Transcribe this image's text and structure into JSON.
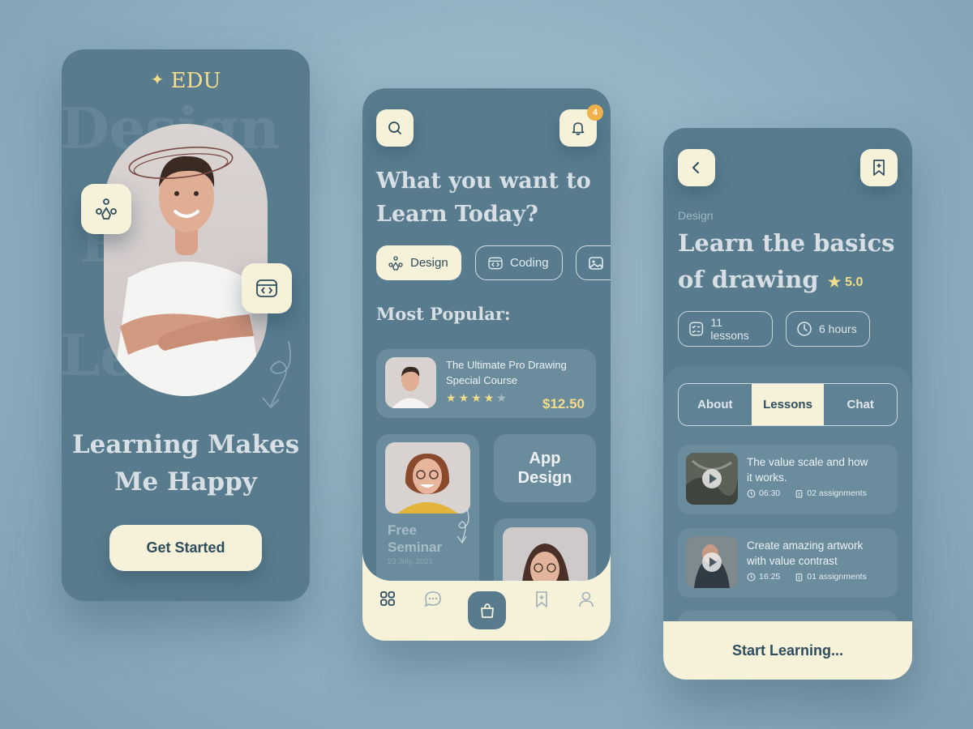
{
  "screen1": {
    "logo_text": "EDU",
    "bg_words": [
      "Design",
      "Pli",
      "Le"
    ],
    "headline_line1": "Learning Makes",
    "headline_line2": "Me Happy",
    "cta_label": "Get Started",
    "float_icons": [
      "design-tool-icon",
      "code-window-icon"
    ]
  },
  "screen2": {
    "notification_count": "4",
    "question_line1": "What you want to",
    "question_line2": "Learn Today?",
    "categories": [
      {
        "label": "Design",
        "icon": "design-tool-icon",
        "active": true
      },
      {
        "label": "Coding",
        "icon": "code-window-icon",
        "active": false
      },
      {
        "label": "",
        "icon": "image-icon",
        "active": false
      }
    ],
    "section_title": "Most Popular:",
    "popular_course": {
      "title_line1": "The Ultimate Pro Drawing",
      "title_line2": "Special Course",
      "rating_stars": 4,
      "rating_max": 5,
      "price": "$12.50"
    },
    "seminar": {
      "line1": "Free",
      "line2": "Seminar",
      "date": "23 July, 2021"
    },
    "app_design": {
      "line1": "App",
      "line2": "Design"
    },
    "nav": [
      "grid-icon",
      "chat-icon",
      "bag-icon",
      "bookmark-icon",
      "profile-icon"
    ]
  },
  "screen3": {
    "category": "Design",
    "title_line1": "Learn the basics",
    "title_line2": "of drawing",
    "rating": "5.0",
    "stats": [
      {
        "label": "11 lessons",
        "icon": "checklist-icon"
      },
      {
        "label": "6 hours",
        "icon": "clock-icon"
      }
    ],
    "tabs": [
      {
        "label": "About",
        "active": false
      },
      {
        "label": "Lessons",
        "active": true
      },
      {
        "label": "Chat",
        "active": false
      }
    ],
    "lessons": [
      {
        "title_line1": "The value scale and how",
        "title_line2": "it works.",
        "duration": "06:30",
        "assignments": "02 assignments"
      },
      {
        "title_line1": "Create amazing artwork",
        "title_line2": "with value contrast",
        "duration": "16:25",
        "assignments": "01 assignments"
      }
    ],
    "footer_label": "Start Learning..."
  },
  "colors": {
    "background": "#8fb0c1",
    "phone": "#587c8e",
    "cream": "#f6f1d9",
    "accent_gold": "#f3dc8a",
    "badge_orange": "#f0b04a",
    "dark_text": "#2d4d5e"
  }
}
